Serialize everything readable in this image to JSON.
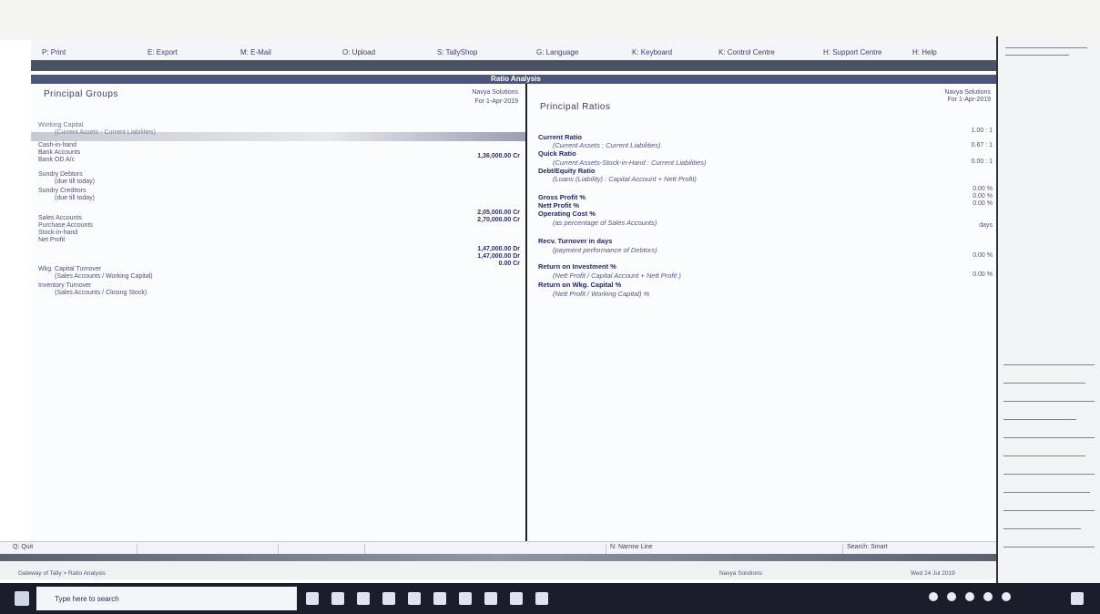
{
  "title": "Ratio Analysis",
  "toolbar": {
    "items": [
      "P: Print",
      "E: Export",
      "M: E-Mail",
      "O: Upload",
      "S: TallyShop",
      "G: Language",
      "K: Keyboard",
      "K: Control Centre",
      "H: Support Centre",
      "H: Help"
    ]
  },
  "window_title": "Ratio Analysis",
  "left": {
    "heading": "Principal Groups",
    "company": "Navya Solutions",
    "period": "For 1-Apr-2019",
    "rows": [
      "Working Capital",
      "(Current Assets - Current Liabilities)",
      "Cash-in-hand",
      "Bank Accounts",
      "Bank OD A/c",
      "Sundry Debtors",
      "(due till today)",
      "Sundry Creditors",
      "(due till today)",
      "Sales Accounts",
      "Purchase Accounts",
      "Stock-in-hand",
      "Net Profit",
      "Wkg. Capital Turnover",
      "(Sales Accounts / Working Capital)",
      "Inventory Turnover",
      "(Sales Accounts / Closing Stock)"
    ],
    "values": [
      "1,36,000.00 Cr",
      "2,05,000.00 Cr",
      "2,70,000.00 Cr",
      "1,47,000.00 Dr",
      "1,47,000.00 Dr",
      "0.00 Cr"
    ]
  },
  "right": {
    "heading": "Principal Ratios",
    "company": "Navya Solutions",
    "period": "For 1-Apr-2019",
    "items": [
      {
        "label": "Current Ratio",
        "style": "b",
        "value": "1.00 : 1"
      },
      {
        "label": "(Current Assets : Current Liabilities)",
        "style": "s",
        "value": "0.67 : 1"
      },
      {
        "label": "Quick Ratio",
        "style": "b",
        "value": ""
      },
      {
        "label": "(Current Assets-Stock-in-Hand : Current Liabilities)",
        "style": "s",
        "value": "0.00 : 1"
      },
      {
        "label": "Debt/Equity Ratio",
        "style": "b",
        "value": ""
      },
      {
        "label": "(Loans (Liability) : Capital Account + Nett Profit)",
        "style": "s",
        "value": ""
      },
      {
        "label": "Gross Profit %",
        "style": "b",
        "value": "0.00 %"
      },
      {
        "label": "Nett Profit %",
        "style": "b",
        "value": "0.00 %"
      },
      {
        "label": "Operating Cost %",
        "style": "b",
        "value": "0.00 %"
      },
      {
        "label": "(as percentage of Sales Accounts)",
        "style": "s",
        "value": ""
      },
      {
        "label": "Recv. Turnover in days",
        "style": "b",
        "value": "days"
      },
      {
        "label": "(payment performance of Debtors)",
        "style": "s",
        "value": "0.00 %"
      },
      {
        "label": "Return on Investment %",
        "style": "b",
        "value": ""
      },
      {
        "label": "(Nett Profit / Capital Account + Nett Profit )",
        "style": "s",
        "value": "0.00 %"
      },
      {
        "label": "Return on Wkg. Capital %",
        "style": "b",
        "value": ""
      },
      {
        "label": "(Nett Profit / Working Capital) %",
        "style": "s",
        "value": ""
      }
    ]
  },
  "status": {
    "quit": "Q: Quit",
    "narrow": "N: Narrow Line",
    "search": "Search: Smart"
  },
  "info": {
    "breadcrumb": "Gateway of Tally > Ratio Analysis",
    "company_line": "Navya Solutions",
    "date": "Wed 24 Jul 2019"
  },
  "taskbar": {
    "search_placeholder": "Type here to search"
  },
  "colors": {
    "accent": "#2a2f6b",
    "window_bar": "#4c5678",
    "taskbar": "#1b1d2b"
  }
}
